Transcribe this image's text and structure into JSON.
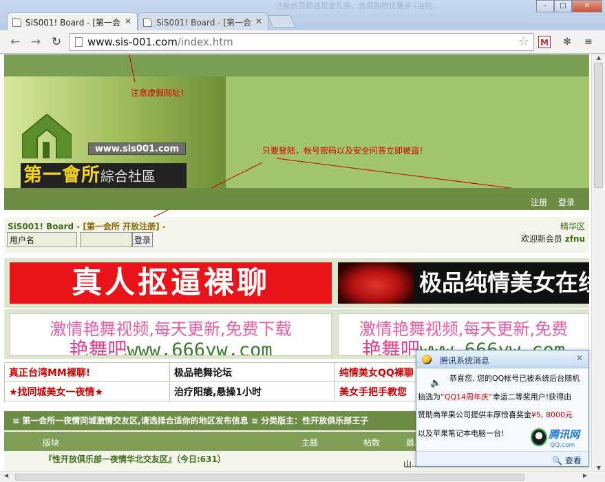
{
  "browser": {
    "tabs": [
      {
        "title": "SiS001! Board - [第一会",
        "active": true
      },
      {
        "title": "SiS001! Board - [第一会",
        "active": false
      }
    ],
    "background_text": "注册会员即送现金礼券、会员购物优惠多  (当前...",
    "url_host": "www.sis-001.com",
    "url_path": "/index.htm",
    "window_buttons": {
      "minimize": "–",
      "maximize": "□",
      "close": "✕"
    },
    "tab_close": "✕",
    "gmail_label": "M"
  },
  "page": {
    "logo": {
      "url": "www.sis001.com",
      "name": "第一會所",
      "sub": "綜合社區"
    },
    "annotations": {
      "fake_url": "注意虚假网址！",
      "login_warning": "只要登陆，帐号密码以及安全问答立即被盗！"
    },
    "nav": {
      "register": "注册",
      "login": "登录"
    },
    "site_title": "SiS001! Board",
    "site_title_rest": " - [第一会所 开放注册] -",
    "login": {
      "username_value": "用户名",
      "password_value": "",
      "submit": "登录"
    },
    "elite": "精华区",
    "welcome_prefix": "欢迎新会员 ",
    "welcome_user": "zfnu",
    "ads": {
      "ad1": "真人抠逼裸聊",
      "ad2": "极品纯情美女在线",
      "ad3_line1": "激情艳舞视频,每天更新,免费下载",
      "ad3_line2_cn": "艳舞吧",
      "ad3_line2_en": "www.666yw.com",
      "ad4_line1": "激情艳舞视频,每天更新,免费",
      "ad4_line2_cn": "艳舞吧",
      "ad4_line2_en": "www.666yw.com"
    },
    "link_rows": [
      [
        "真正台湾MM裸聊!",
        "极品艳舞论坛",
        "纯情美女QQ裸聊"
      ],
      [
        "★找同城美女一夜情★",
        "治疗阳痿,悬操1小时",
        "美女手把手教您"
      ]
    ],
    "forum_header": "≡ 第一会所一夜情同城激情交友区,请选择合适你的地区发布信息 ≡ 分类版主：性开放俱乐部王子",
    "forum_columns": {
      "board": "版块",
      "topics": "主题",
      "posts": "帖数",
      "last": "最..."
    },
    "forum_row": {
      "name": "『性开放俱乐部一夜情华北交友区』（今日:631）",
      "extra": "山..."
    }
  },
  "popup": {
    "title": "腾讯系统消息",
    "line1": "恭喜您, 您的QQ帐号已被系统后台随机",
    "line2_a": "抽选为",
    "line2_red": "“QQ14周年庆”",
    "line2_b": "幸运二等奖用户!获得由",
    "line3_a": "赞助商苹果公司提供丰厚惊喜奖金",
    "line3_red": "¥5, 8000元",
    "line4": "以及苹果笔记本电脑一台!",
    "brand": "腾讯网",
    "brand_domain": "QQ.com",
    "view": "查看",
    "close": "✕"
  }
}
